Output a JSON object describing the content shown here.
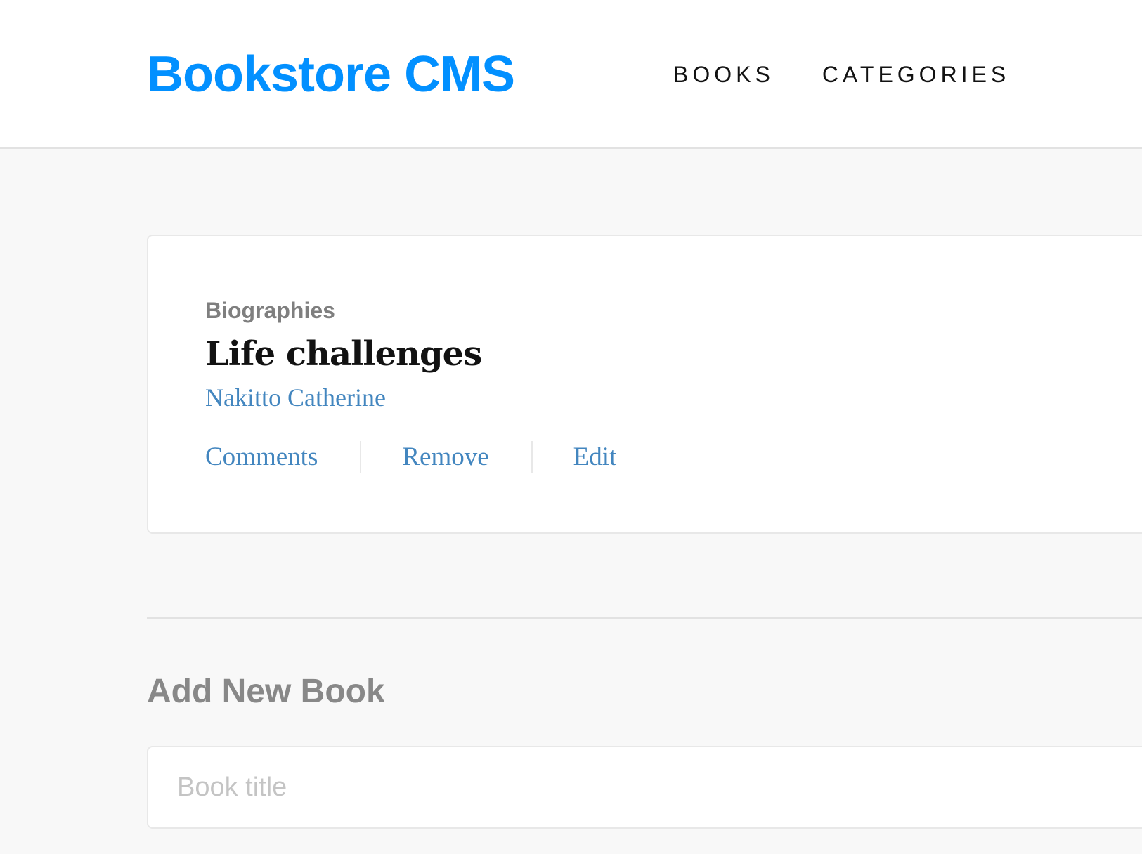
{
  "header": {
    "logo": "Bookstore CMS",
    "nav": [
      {
        "label": "BOOKS"
      },
      {
        "label": "CATEGORIES"
      }
    ]
  },
  "books": [
    {
      "category": "Biographies",
      "title": "Life challenges",
      "author": "Nakitto Catherine",
      "actions": {
        "comments": "Comments",
        "remove": "Remove",
        "edit": "Edit"
      }
    }
  ],
  "form": {
    "heading": "Add New Book",
    "title_placeholder": "Book title",
    "title_value": ""
  },
  "colors": {
    "brand": "#0290ff",
    "link": "#4386bf",
    "muted": "#888888",
    "background": "#f8f8f8"
  }
}
